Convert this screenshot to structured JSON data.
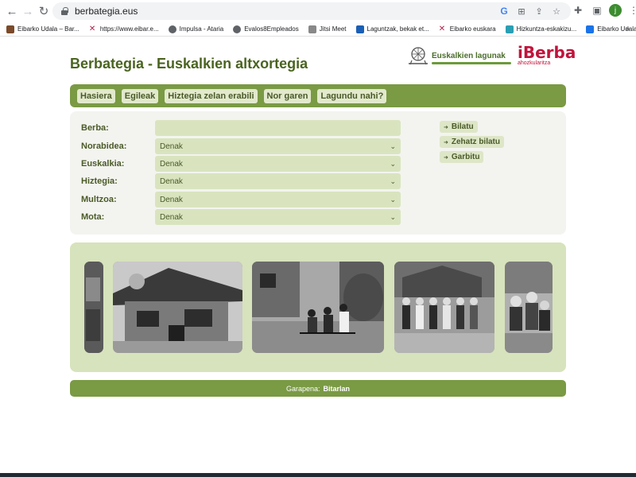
{
  "browser": {
    "url": "berbategia.eus",
    "avatar_initial": "j",
    "bookmarks": [
      {
        "label": "Eibarko Udala – Bar...",
        "icon": "eibar-icon",
        "color": "#7b4a2a"
      },
      {
        "label": "https://www.eibar.e...",
        "icon": "x-icon",
        "color": "#b0204a"
      },
      {
        "label": "Impulsa - Ataria",
        "icon": "globe-icon",
        "color": "#5f6368"
      },
      {
        "label": "Evalos8Empleados",
        "icon": "globe-icon",
        "color": "#5f6368"
      },
      {
        "label": "Jitsi Meet",
        "icon": "jitsi-icon",
        "color": "#888888"
      },
      {
        "label": "Laguntzak, bekak et...",
        "icon": "doc-icon",
        "color": "#1a5fb4"
      },
      {
        "label": "Eibarko euskara",
        "icon": "x-icon",
        "color": "#b0204a"
      },
      {
        "label": "Hizkuntza-eskakizu...",
        "icon": "wave-icon",
        "color": "#2a9fb4"
      },
      {
        "label": "Eibarko Udala",
        "icon": "eibar-udala-icon",
        "color": "#1a73e8"
      }
    ]
  },
  "site": {
    "title": "Berbategia - Euskalkien altxortegia",
    "logo_lagunak": "Euskalkien lagunak",
    "logo_iberba": "iBerba",
    "logo_iberba_sub": "ahozkularitza"
  },
  "nav": [
    "Hasiera",
    "Egileak",
    "Hiztegia zelan erabili",
    "Nor garen",
    "Lagundu nahi?"
  ],
  "form": {
    "berba_label": "Berba:",
    "berba_value": "",
    "fields": [
      {
        "label": "Norabidea:",
        "value": "Denak"
      },
      {
        "label": "Euskalkia:",
        "value": "Denak"
      },
      {
        "label": "Hiztegia:",
        "value": "Denak"
      },
      {
        "label": "Multzoa:",
        "value": "Denak"
      },
      {
        "label": "Mota:",
        "value": "Denak"
      }
    ]
  },
  "actions": [
    "Bilatu",
    "Zehatz bilatu",
    "Garbitu"
  ],
  "footer": {
    "prefix": "Garapena:",
    "brand": "Bitarlan"
  },
  "colors": {
    "accent": "#7a9a44",
    "title": "#4a6420",
    "input_bg": "#d9e4bf",
    "gallery_bg": "#d7e3bc"
  }
}
